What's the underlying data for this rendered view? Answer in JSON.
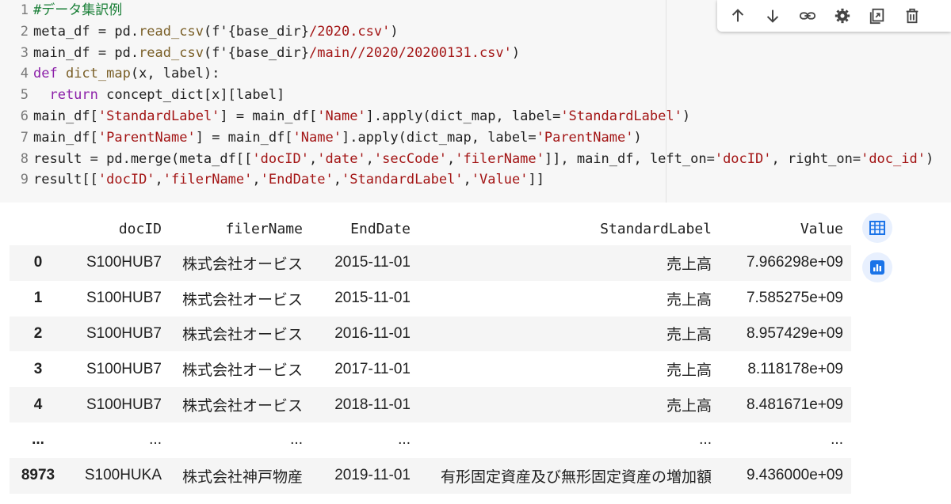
{
  "code": {
    "lines": [
      {
        "num": "1",
        "parts": [
          {
            "t": "#データ集訳例",
            "c": "c-cm"
          }
        ]
      },
      {
        "num": "2",
        "parts": [
          {
            "t": "meta_df = pd.",
            "c": ""
          },
          {
            "t": "read_csv",
            "c": "c-fn"
          },
          {
            "t": "(f'{base_dir}",
            "c": ""
          },
          {
            "t": "/2020.csv'",
            "c": "c-st"
          },
          {
            "t": ")",
            "c": ""
          }
        ]
      },
      {
        "num": "3",
        "parts": [
          {
            "t": "main_df = pd.",
            "c": ""
          },
          {
            "t": "read_csv",
            "c": "c-fn"
          },
          {
            "t": "(f'{base_dir}",
            "c": ""
          },
          {
            "t": "/main//2020/20200131.csv'",
            "c": "c-st"
          },
          {
            "t": ")",
            "c": ""
          }
        ]
      },
      {
        "num": "4",
        "parts": [
          {
            "t": "def ",
            "c": "c-kw"
          },
          {
            "t": "dict_map",
            "c": "c-fn"
          },
          {
            "t": "(x, label):",
            "c": ""
          }
        ]
      },
      {
        "num": "5",
        "parts": [
          {
            "t": "  return ",
            "c": "c-kw"
          },
          {
            "t": "concept_dict[x][label]",
            "c": ""
          }
        ]
      },
      {
        "num": "6",
        "parts": [
          {
            "t": "main_df[",
            "c": ""
          },
          {
            "t": "'StandardLabel'",
            "c": "c-st"
          },
          {
            "t": "] = main_df[",
            "c": ""
          },
          {
            "t": "'Name'",
            "c": "c-st"
          },
          {
            "t": "].apply(dict_map, label=",
            "c": ""
          },
          {
            "t": "'StandardLabel'",
            "c": "c-st"
          },
          {
            "t": ")",
            "c": ""
          }
        ]
      },
      {
        "num": "7",
        "parts": [
          {
            "t": "main_df[",
            "c": ""
          },
          {
            "t": "'ParentName'",
            "c": "c-st"
          },
          {
            "t": "] = main_df[",
            "c": ""
          },
          {
            "t": "'Name'",
            "c": "c-st"
          },
          {
            "t": "].apply(dict_map, label=",
            "c": ""
          },
          {
            "t": "'ParentName'",
            "c": "c-st"
          },
          {
            "t": ")",
            "c": ""
          }
        ]
      },
      {
        "num": "8",
        "parts": [
          {
            "t": "result = pd.merge(meta_df[[",
            "c": ""
          },
          {
            "t": "'docID'",
            "c": "c-st"
          },
          {
            "t": ",",
            "c": ""
          },
          {
            "t": "'date'",
            "c": "c-st"
          },
          {
            "t": ",",
            "c": ""
          },
          {
            "t": "'secCode'",
            "c": "c-st"
          },
          {
            "t": ",",
            "c": ""
          },
          {
            "t": "'filerName'",
            "c": "c-st"
          },
          {
            "t": "]], main_df, left_on=",
            "c": ""
          },
          {
            "t": "'docID'",
            "c": "c-st"
          },
          {
            "t": ", right_on=",
            "c": ""
          },
          {
            "t": "'doc_id'",
            "c": "c-st"
          },
          {
            "t": ")",
            "c": ""
          }
        ]
      },
      {
        "num": "9",
        "parts": [
          {
            "t": "result[[",
            "c": ""
          },
          {
            "t": "'docID'",
            "c": "c-st"
          },
          {
            "t": ",",
            "c": ""
          },
          {
            "t": "'filerName'",
            "c": "c-st"
          },
          {
            "t": ",",
            "c": ""
          },
          {
            "t": "'EndDate'",
            "c": "c-st"
          },
          {
            "t": ",",
            "c": ""
          },
          {
            "t": "'StandardLabel'",
            "c": "c-st"
          },
          {
            "t": ",",
            "c": ""
          },
          {
            "t": "'Value'",
            "c": "c-st"
          },
          {
            "t": "]]",
            "c": ""
          }
        ]
      }
    ]
  },
  "toolbar": {
    "icons": [
      "arrow-up-icon",
      "arrow-down-icon",
      "link-icon",
      "gear-icon",
      "mirror-cell-icon",
      "delete-icon"
    ]
  },
  "table": {
    "columns": [
      "docID",
      "filerName",
      "EndDate",
      "StandardLabel",
      "Value"
    ],
    "rows": [
      {
        "index": "0",
        "docID": "S100HUB7",
        "filerName": "株式会社オービス",
        "EndDate": "2015-11-01",
        "StandardLabel": "売上高",
        "Value": "7.966298e+09"
      },
      {
        "index": "1",
        "docID": "S100HUB7",
        "filerName": "株式会社オービス",
        "EndDate": "2015-11-01",
        "StandardLabel": "売上高",
        "Value": "7.585275e+09"
      },
      {
        "index": "2",
        "docID": "S100HUB7",
        "filerName": "株式会社オービス",
        "EndDate": "2016-11-01",
        "StandardLabel": "売上高",
        "Value": "8.957429e+09"
      },
      {
        "index": "3",
        "docID": "S100HUB7",
        "filerName": "株式会社オービス",
        "EndDate": "2017-11-01",
        "StandardLabel": "売上高",
        "Value": "8.118178e+09"
      },
      {
        "index": "4",
        "docID": "S100HUB7",
        "filerName": "株式会社オービス",
        "EndDate": "2018-11-01",
        "StandardLabel": "売上高",
        "Value": "8.481671e+09"
      },
      {
        "index": "...",
        "docID": "...",
        "filerName": "...",
        "EndDate": "...",
        "StandardLabel": "...",
        "Value": "..."
      },
      {
        "index": "8973",
        "docID": "S100HUKA",
        "filerName": "株式会社神戸物産",
        "EndDate": "2019-11-01",
        "StandardLabel": "有形固定資産及び無形固定資産の増加額",
        "Value": "9.436000e+09"
      }
    ]
  },
  "side_buttons": [
    "table-view-icon",
    "chart-suggest-icon"
  ],
  "colors": {
    "accent": "#1a73e8",
    "side_bg": "#e8f0fe",
    "stripe": "#f5f5f5",
    "code_bg": "#f7f7f7"
  }
}
